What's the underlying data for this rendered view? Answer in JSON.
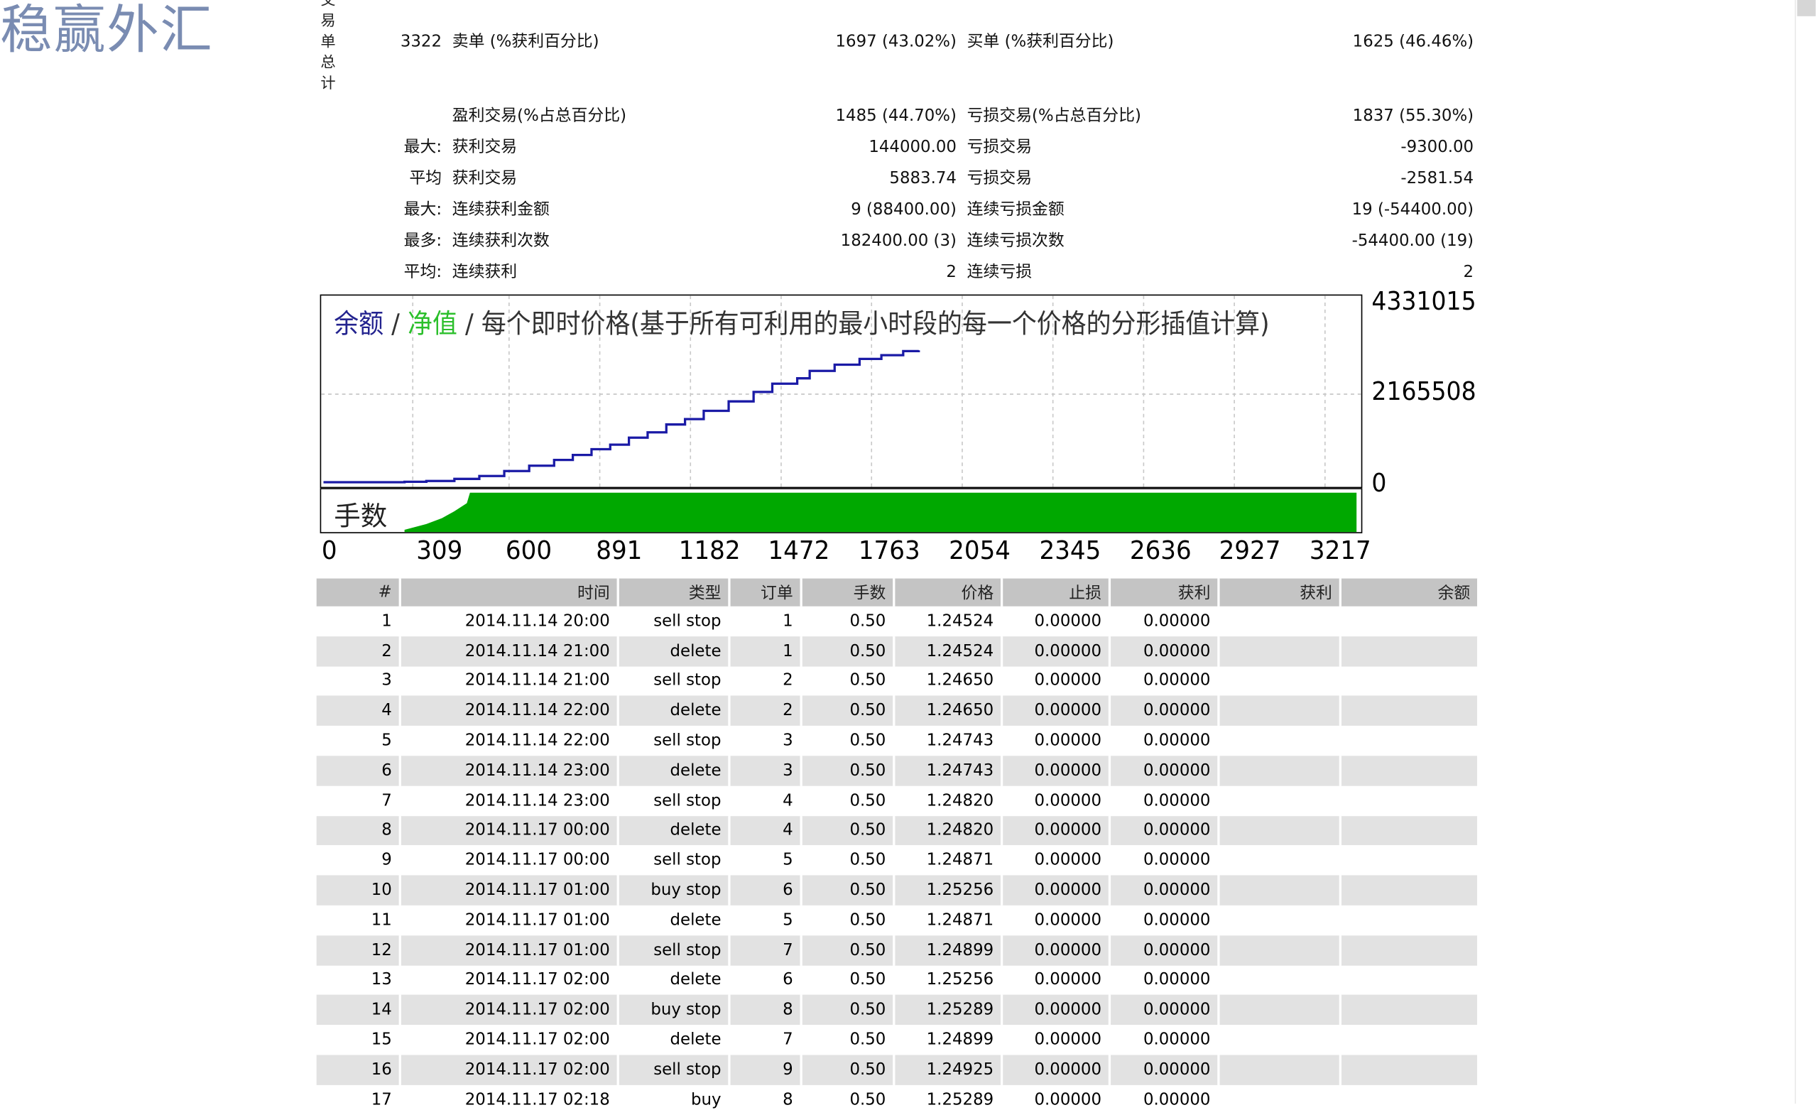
{
  "logo_text": "稳赢外汇",
  "summary_side_label": [
    "交",
    "易",
    "单",
    "总",
    "计"
  ],
  "summary": {
    "total_trades": "3322",
    "sell_label": "卖单 (%获利百分比)",
    "sell_value": "1697 (43.02%)",
    "buy_label": "买单 (%获利百分比)",
    "buy_value": "1625 (46.46%)",
    "profit_trades_label": "盈利交易(%占总百分比)",
    "profit_trades_value": "1485 (44.70%)",
    "loss_trades_label": "亏损交易(%占总百分比)",
    "loss_trades_value": "1837 (55.30%)",
    "max_label": "最大:",
    "largest_profit_label": "获利交易",
    "largest_profit_value": "144000.00",
    "largest_loss_label": "亏损交易",
    "largest_loss_value": "-9300.00",
    "avg_label": "平均",
    "avg_profit_label": "获利交易",
    "avg_profit_value": "5883.74",
    "avg_loss_label": "亏损交易",
    "avg_loss_value": "-2581.54",
    "max2_label": "最大:",
    "max_consec_wins_label": "连续获利金额",
    "max_consec_wins_value": "9 (88400.00)",
    "max_consec_losses_label": "连续亏损金额",
    "max_consec_losses_value": "19 (-54400.00)",
    "most_label": "最多:",
    "max_consec_profit_label": "连续获利次数",
    "max_consec_profit_value": "182400.00 (3)",
    "max_consec_loss_label": "连续亏损次数",
    "max_consec_loss_value": "-54400.00 (19)",
    "avg2_label": "平均:",
    "avg_consec_wins_label": "连续获利",
    "avg_consec_wins_value": "2",
    "avg_consec_losses_label": "连续亏损",
    "avg_consec_losses_value": "2"
  },
  "chart_data": {
    "type": "line",
    "title_balance": "余额",
    "title_sep1": " / ",
    "title_equity": "净值",
    "title_rest": " / 每个即时价格(基于所有可利用的最小时段的每一个价格的分形插值计算)",
    "volume_label": "手数",
    "x_tick_labels": [
      "0",
      "309",
      "600",
      "891",
      "1182",
      "1472",
      "1763",
      "2054",
      "2345",
      "2636",
      "2927",
      "3217"
    ],
    "y_tick_labels": [
      "4331015",
      "2165508",
      "0"
    ],
    "ylim": [
      0,
      4331015
    ],
    "xlim": [
      0,
      3322
    ],
    "series": [
      {
        "name": "余额",
        "color": "#1a1aa6",
        "x": [
          0,
          260,
          330,
          420,
          500,
          580,
          660,
          740,
          800,
          860,
          920,
          980,
          1040,
          1100,
          1160,
          1220,
          1300,
          1380,
          1440,
          1520,
          1560,
          1640,
          1720,
          1790,
          1860,
          1910
        ],
        "y": [
          30000,
          40000,
          60000,
          110000,
          180000,
          300000,
          430000,
          570000,
          690000,
          830000,
          940000,
          1110000,
          1240000,
          1430000,
          1560000,
          1760000,
          1990000,
          2220000,
          2420000,
          2550000,
          2730000,
          2880000,
          3020000,
          3110000,
          3210000,
          3230000
        ]
      }
    ],
    "volume_fill_color": "#00a800",
    "grid": true
  },
  "table": {
    "headers": [
      "#",
      "时间",
      "类型",
      "订单",
      "手数",
      "价格",
      "止损",
      "获利",
      "获利",
      "余额"
    ],
    "rows": [
      [
        "1",
        "2014.11.14 20:00",
        "sell stop",
        "1",
        "0.50",
        "1.24524",
        "0.00000",
        "0.00000",
        "",
        ""
      ],
      [
        "2",
        "2014.11.14 21:00",
        "delete",
        "1",
        "0.50",
        "1.24524",
        "0.00000",
        "0.00000",
        "",
        ""
      ],
      [
        "3",
        "2014.11.14 21:00",
        "sell stop",
        "2",
        "0.50",
        "1.24650",
        "0.00000",
        "0.00000",
        "",
        ""
      ],
      [
        "4",
        "2014.11.14 22:00",
        "delete",
        "2",
        "0.50",
        "1.24650",
        "0.00000",
        "0.00000",
        "",
        ""
      ],
      [
        "5",
        "2014.11.14 22:00",
        "sell stop",
        "3",
        "0.50",
        "1.24743",
        "0.00000",
        "0.00000",
        "",
        ""
      ],
      [
        "6",
        "2014.11.14 23:00",
        "delete",
        "3",
        "0.50",
        "1.24743",
        "0.00000",
        "0.00000",
        "",
        ""
      ],
      [
        "7",
        "2014.11.14 23:00",
        "sell stop",
        "4",
        "0.50",
        "1.24820",
        "0.00000",
        "0.00000",
        "",
        ""
      ],
      [
        "8",
        "2014.11.17 00:00",
        "delete",
        "4",
        "0.50",
        "1.24820",
        "0.00000",
        "0.00000",
        "",
        ""
      ],
      [
        "9",
        "2014.11.17 00:00",
        "sell stop",
        "5",
        "0.50",
        "1.24871",
        "0.00000",
        "0.00000",
        "",
        ""
      ],
      [
        "10",
        "2014.11.17 01:00",
        "buy stop",
        "6",
        "0.50",
        "1.25256",
        "0.00000",
        "0.00000",
        "",
        ""
      ],
      [
        "11",
        "2014.11.17 01:00",
        "delete",
        "5",
        "0.50",
        "1.24871",
        "0.00000",
        "0.00000",
        "",
        ""
      ],
      [
        "12",
        "2014.11.17 01:00",
        "sell stop",
        "7",
        "0.50",
        "1.24899",
        "0.00000",
        "0.00000",
        "",
        ""
      ],
      [
        "13",
        "2014.11.17 02:00",
        "delete",
        "6",
        "0.50",
        "1.25256",
        "0.00000",
        "0.00000",
        "",
        ""
      ],
      [
        "14",
        "2014.11.17 02:00",
        "buy stop",
        "8",
        "0.50",
        "1.25289",
        "0.00000",
        "0.00000",
        "",
        ""
      ],
      [
        "15",
        "2014.11.17 02:00",
        "delete",
        "7",
        "0.50",
        "1.24899",
        "0.00000",
        "0.00000",
        "",
        ""
      ],
      [
        "16",
        "2014.11.17 02:00",
        "sell stop",
        "9",
        "0.50",
        "1.24925",
        "0.00000",
        "0.00000",
        "",
        ""
      ],
      [
        "17",
        "2014.11.17 02:18",
        "buy",
        "8",
        "0.50",
        "1.25289",
        "0.00000",
        "0.00000",
        "",
        ""
      ]
    ]
  }
}
